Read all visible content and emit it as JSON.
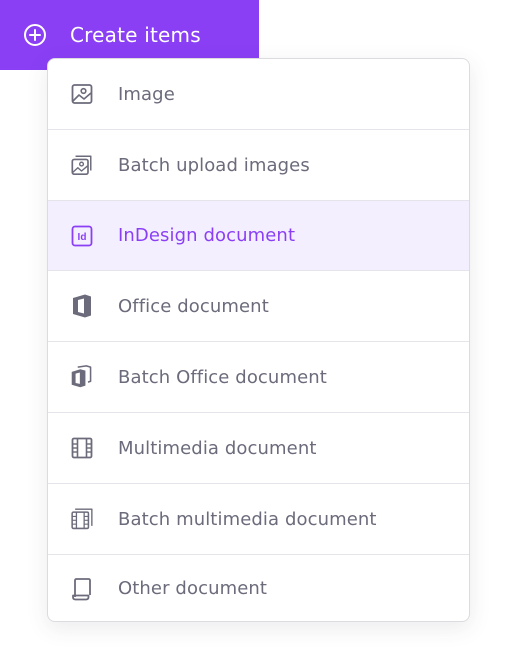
{
  "create_button": {
    "label": "Create items",
    "icon": "plus-circle-icon"
  },
  "menu": {
    "items": [
      {
        "label": "Image",
        "icon": "image-icon",
        "active": false
      },
      {
        "label": "Batch upload images",
        "icon": "images-stack-icon",
        "active": false
      },
      {
        "label": "InDesign document",
        "icon": "indesign-icon",
        "active": true
      },
      {
        "label": "Office document",
        "icon": "office-icon",
        "active": false
      },
      {
        "label": "Batch Office document",
        "icon": "office-stack-icon",
        "active": false
      },
      {
        "label": "Multimedia document",
        "icon": "film-icon",
        "active": false
      },
      {
        "label": "Batch multimedia document",
        "icon": "film-stack-icon",
        "active": false
      },
      {
        "label": "Other document",
        "icon": "document-icon",
        "active": false
      }
    ]
  },
  "colors": {
    "accent": "#8a3ff5",
    "active_bg": "#f4effe",
    "text": "#6b6b7b",
    "icon": "#6b6b7b"
  }
}
